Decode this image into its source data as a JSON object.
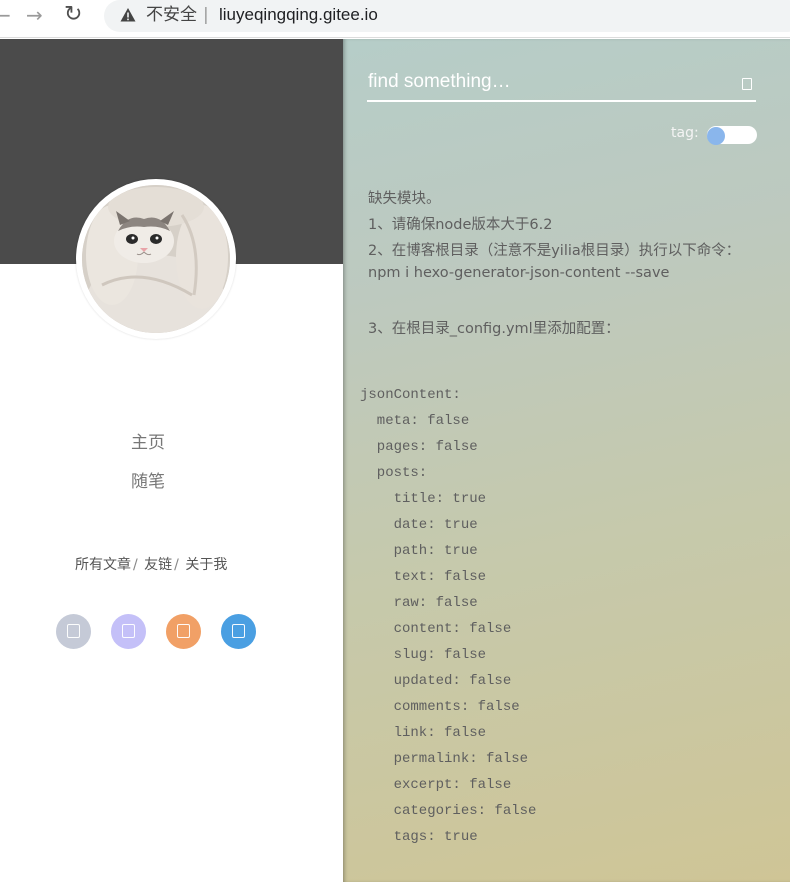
{
  "browser": {
    "insecure_label": "不安全",
    "separator": "|",
    "url": "liuyeqingqing.gitee.io"
  },
  "sidebar": {
    "menu": [
      {
        "label": "主页"
      },
      {
        "label": "随笔"
      }
    ],
    "links": [
      {
        "label": "所有文章"
      },
      {
        "label": "友链"
      },
      {
        "label": "关于我"
      }
    ],
    "link_separator": "/",
    "social_colors": [
      "#c5cad7",
      "#c4c0f8",
      "#f1a066",
      "#4a9fe2"
    ],
    "banner_color": "#4b4b4b"
  },
  "search": {
    "placeholder": "find something…",
    "tag_label": "tag:"
  },
  "message": {
    "lines": [
      "缺失模块。",
      "1、请确保node版本大于6.2",
      "2、在博客根目录（注意不是yilia根目录）执行以下命令：",
      "npm i hexo-generator-json-content --save",
      "3、在根目录_config.yml里添加配置："
    ]
  },
  "code": {
    "lines": [
      "jsonContent:",
      "  meta: false",
      "  pages: false",
      "  posts:",
      "    title: true",
      "    date: true",
      "    path: true",
      "    text: false",
      "    raw: false",
      "    content: false",
      "    slug: false",
      "    updated: false",
      "    comments: false",
      "    link: false",
      "    permalink: false",
      "    excerpt: false",
      "    categories: false",
      "    tags: true"
    ]
  }
}
